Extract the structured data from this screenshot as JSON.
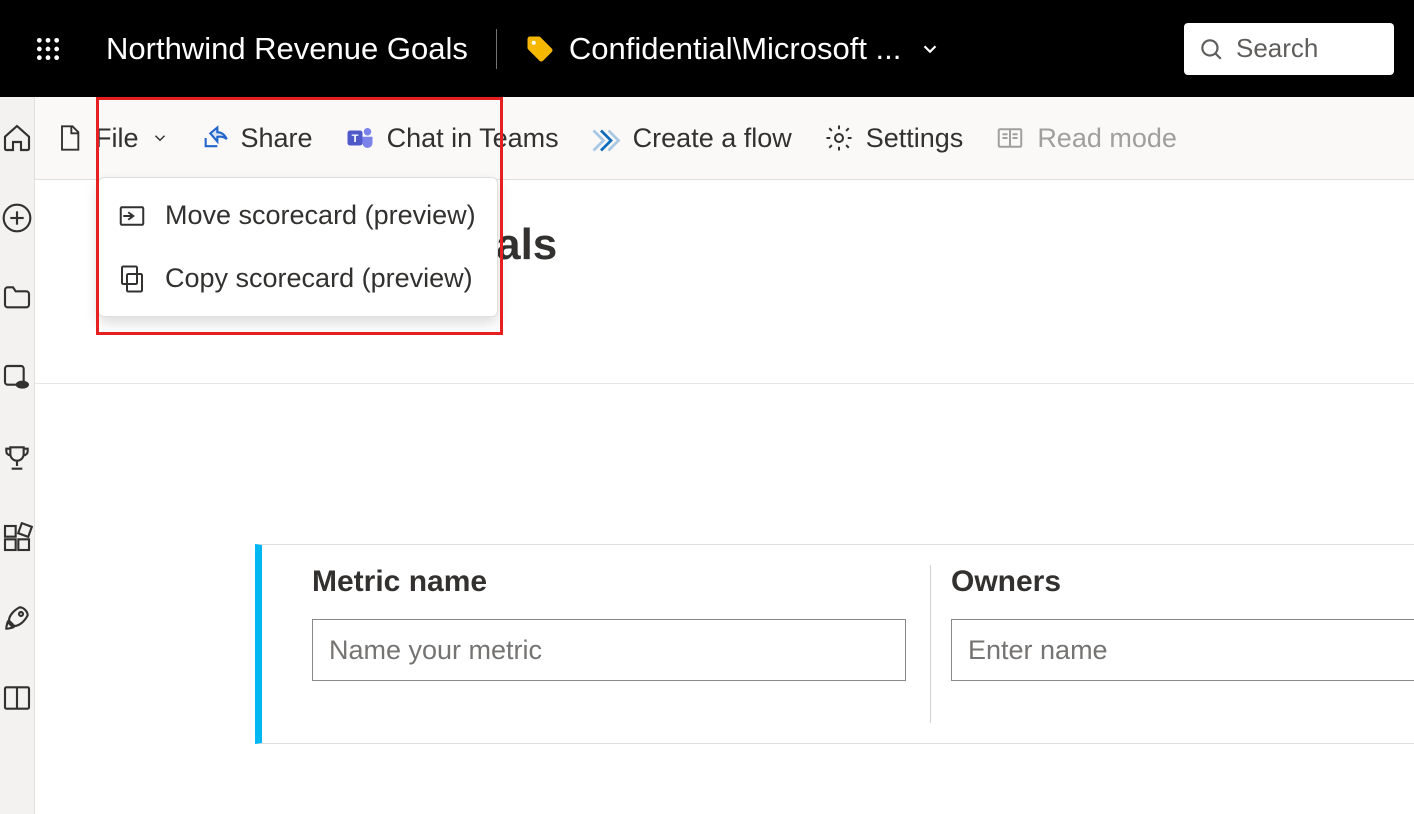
{
  "header": {
    "document_title": "Northwind Revenue Goals",
    "sensitivity_label": "Confidential\\Microsoft ...",
    "search_placeholder": "Search"
  },
  "commandbar": {
    "file": "File",
    "share": "Share",
    "chat_in_teams": "Chat in Teams",
    "create_a_flow": "Create a flow",
    "settings": "Settings",
    "read_mode": "Read mode"
  },
  "file_menu": {
    "move": "Move scorecard (preview)",
    "copy": "Copy scorecard (preview)"
  },
  "page": {
    "title_partial": "Goals"
  },
  "metric": {
    "name_label": "Metric name",
    "name_placeholder": "Name your metric",
    "owners_label": "Owners",
    "owners_placeholder": "Enter name"
  }
}
